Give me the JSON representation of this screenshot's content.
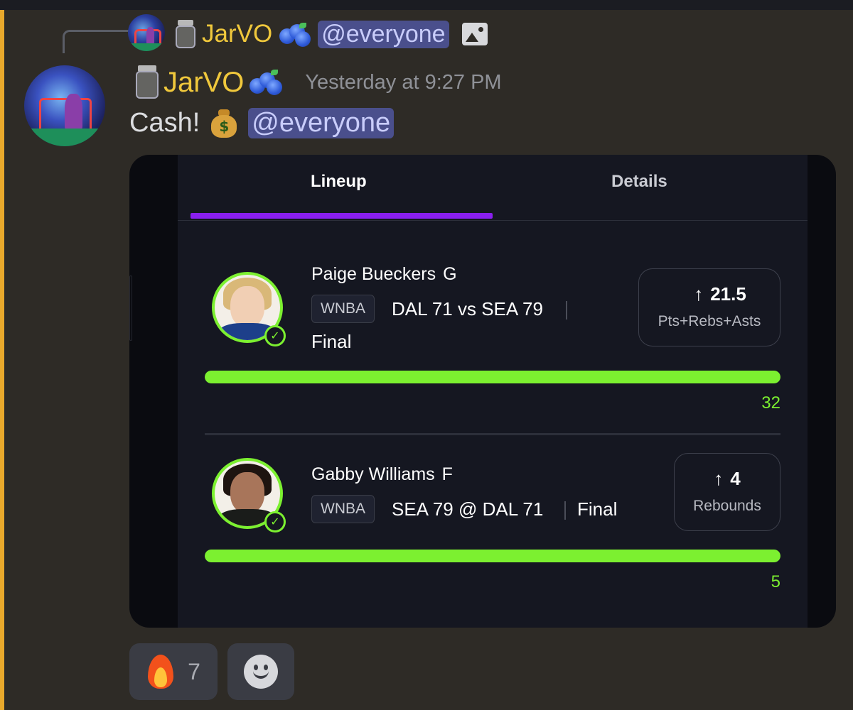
{
  "reply": {
    "author": "JarVO",
    "mention": "@everyone"
  },
  "message": {
    "author": "JarVO",
    "timestamp": "Yesterday at 9:27 PM",
    "text": "Cash!",
    "mention": "@everyone"
  },
  "embed": {
    "tabs": [
      "Lineup",
      "Details"
    ],
    "picks": [
      {
        "player": "Paige Bueckers",
        "position": "G",
        "league": "WNBA",
        "game": "DAL 71 vs SEA 79",
        "status": "Final",
        "line_value": "21.5",
        "line_stat": "Pts+Rebs+Asts",
        "actual": "32",
        "progress": 1.0
      },
      {
        "player": "Gabby Williams",
        "position": "F",
        "league": "WNBA",
        "game": "SEA 79 @ DAL 71",
        "status": "Final",
        "line_value": "4",
        "line_stat": "Rebounds",
        "actual": "5",
        "progress": 1.0
      }
    ]
  },
  "reactions": [
    {
      "emoji": "fire",
      "count": "7"
    }
  ],
  "icons": {
    "reply_image": "image-icon",
    "add_reaction": "smiley-icon",
    "direction": "up-arrow-icon",
    "check": "check-icon"
  },
  "colors": {
    "accent_bar": "#e8a92c",
    "author": "#f0c83c",
    "mention_bg": "#4a4f8c",
    "tab_underline": "#8a1ff0",
    "progress": "#7cf030"
  }
}
